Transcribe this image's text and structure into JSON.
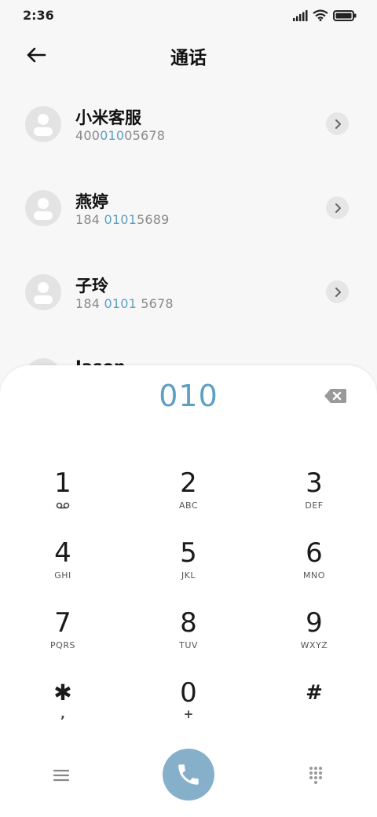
{
  "status": {
    "time": "2:36"
  },
  "header": {
    "title": "通话"
  },
  "contacts": [
    {
      "name": "小米客服",
      "number_pre": "400",
      "number_hl": "010",
      "number_post": "05678"
    },
    {
      "name": "燕婷",
      "number_pre": "184 ",
      "number_hl": "0101",
      "number_post": "5689"
    },
    {
      "name": "子玲",
      "number_pre": "184 ",
      "number_hl": "0101",
      "number_post": " 5678"
    },
    {
      "name": "Jason"
    }
  ],
  "dialer": {
    "input": "010",
    "keys": [
      {
        "digit": "1",
        "letters": ""
      },
      {
        "digit": "2",
        "letters": "ABC"
      },
      {
        "digit": "3",
        "letters": "DEF"
      },
      {
        "digit": "4",
        "letters": "GHI"
      },
      {
        "digit": "5",
        "letters": "JKL"
      },
      {
        "digit": "6",
        "letters": "MNO"
      },
      {
        "digit": "7",
        "letters": "PQRS"
      },
      {
        "digit": "8",
        "letters": "TUV"
      },
      {
        "digit": "9",
        "letters": "WXYZ"
      },
      {
        "digit": "✱",
        "symbol": ","
      },
      {
        "digit": "0",
        "symbol": "+"
      },
      {
        "digit": "#",
        "symbol": ""
      }
    ]
  },
  "colors": {
    "accent": "#5f9fc4",
    "call_button": "#86b0ca"
  },
  "icons": [
    "back-arrow-icon",
    "chevron-right-icon",
    "avatar-icon",
    "backspace-icon",
    "voicemail-icon",
    "menu-icon",
    "phone-icon",
    "dialpad-icon",
    "signal-icon",
    "wifi-icon",
    "battery-icon"
  ]
}
